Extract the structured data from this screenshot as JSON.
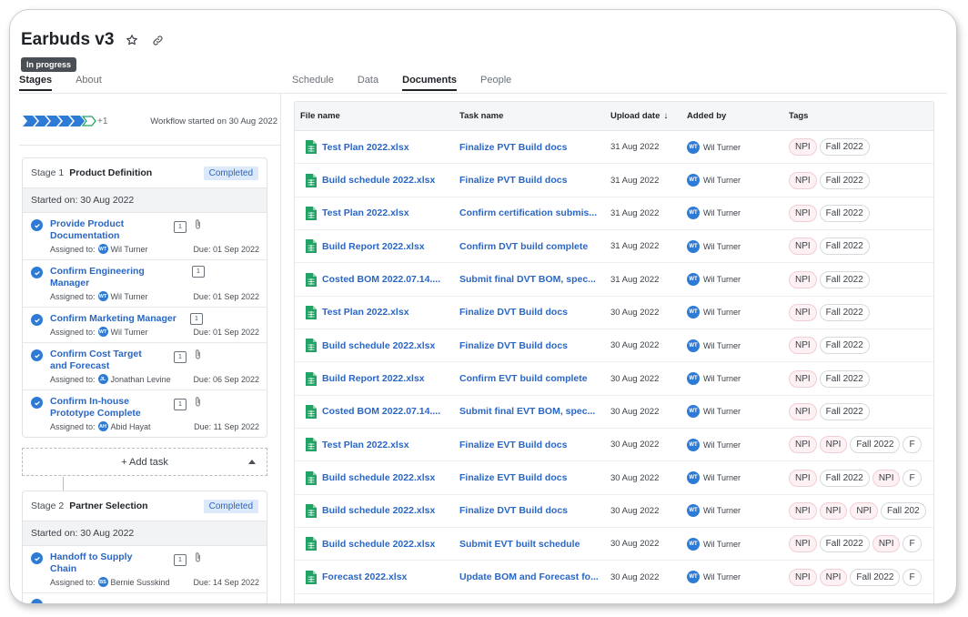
{
  "project": {
    "title": "Earbuds v3",
    "status": "In progress"
  },
  "left_tabs": [
    {
      "label": "Stages",
      "active": true
    },
    {
      "label": "About",
      "active": false
    }
  ],
  "right_tabs": [
    {
      "label": "Schedule",
      "active": false
    },
    {
      "label": "Data",
      "active": false
    },
    {
      "label": "Documents",
      "active": true
    },
    {
      "label": "People",
      "active": false
    }
  ],
  "workflow": {
    "extra_count": "+1",
    "started_text": "Workflow started on 30 Aug 2022"
  },
  "stages": [
    {
      "number": "Stage 1",
      "name": "Product Definition",
      "status": "Completed",
      "started": "Started on: 30 Aug 2022",
      "tasks": [
        {
          "title": "Provide Product Documentation",
          "assigned_label": "Assigned to:",
          "initials": "WT",
          "assignee": "Wil Turner",
          "due": "Due: 01 Sep 2022",
          "comments": "1",
          "attachment": true
        },
        {
          "title": "Confirm Engineering Manager",
          "assigned_label": "Assigned to:",
          "initials": "WT",
          "assignee": "Wil Turner",
          "due": "Due: 01 Sep 2022",
          "comments": "1",
          "attachment": false
        },
        {
          "title": "Confirm Marketing Manager",
          "assigned_label": "Assigned to:",
          "initials": "WT",
          "assignee": "Wil Turner",
          "due": "Due: 01 Sep 2022",
          "comments": "1",
          "attachment": false
        },
        {
          "title": "Confirm Cost Target and Forecast",
          "assigned_label": "Assigned to:",
          "initials": "JL",
          "assignee": "Jonathan Levine",
          "due": "Due: 06 Sep 2022",
          "comments": "1",
          "attachment": true
        },
        {
          "title": "Confirm In-house Prototype Complete",
          "assigned_label": "Assigned to:",
          "initials": "AH",
          "assignee": "Abid Hayat",
          "due": "Due: 11 Sep 2022",
          "comments": "1",
          "attachment": true
        }
      ],
      "add_task": "+ Add task"
    },
    {
      "number": "Stage 2",
      "name": "Partner Selection",
      "status": "Completed",
      "started": "Started on: 30 Aug 2022",
      "tasks": [
        {
          "title": "Handoff to Supply Chain",
          "assigned_label": "Assigned to:",
          "initials": "BS",
          "assignee": "Bernie Susskind",
          "due": "Due: 14 Sep 2022",
          "comments": "1",
          "attachment": true
        }
      ]
    }
  ],
  "documents": {
    "columns": {
      "file": "File name",
      "task": "Task name",
      "date": "Upload date",
      "added": "Added by",
      "tags": "Tags"
    },
    "sort_icon": "arrow-down-icon",
    "rows": [
      {
        "file": "Test Plan 2022.xlsx",
        "task": "Finalize PVT Build docs",
        "date": "31 Aug 2022",
        "initials": "WT",
        "added": "Wil Turner",
        "tags": [
          "NPI",
          "Fall 2022"
        ]
      },
      {
        "file": "Build schedule 2022.xlsx",
        "task": "Finalize PVT Build docs",
        "date": "31 Aug 2022",
        "initials": "WT",
        "added": "Wil Turner",
        "tags": [
          "NPI",
          "Fall 2022"
        ]
      },
      {
        "file": "Test Plan 2022.xlsx",
        "task": "Confirm certification submis...",
        "date": "31 Aug 2022",
        "initials": "WT",
        "added": "Wil Turner",
        "tags": [
          "NPI",
          "Fall 2022"
        ]
      },
      {
        "file": "Build Report 2022.xlsx",
        "task": "Confirm DVT build complete",
        "date": "31 Aug 2022",
        "initials": "WT",
        "added": "Wil Turner",
        "tags": [
          "NPI",
          "Fall 2022"
        ]
      },
      {
        "file": "Costed BOM 2022.07.14....",
        "task": "Submit final DVT BOM, spec...",
        "date": "31 Aug 2022",
        "initials": "WT",
        "added": "Wil Turner",
        "tags": [
          "NPI",
          "Fall 2022"
        ]
      },
      {
        "file": "Test Plan 2022.xlsx",
        "task": "Finalize DVT Build docs",
        "date": "30 Aug 2022",
        "initials": "WT",
        "added": "Wil Turner",
        "tags": [
          "NPI",
          "Fall 2022"
        ]
      },
      {
        "file": "Build schedule 2022.xlsx",
        "task": "Finalize DVT Build docs",
        "date": "30 Aug 2022",
        "initials": "WT",
        "added": "Wil Turner",
        "tags": [
          "NPI",
          "Fall 2022"
        ]
      },
      {
        "file": "Build Report 2022.xlsx",
        "task": "Confirm EVT build complete",
        "date": "30 Aug 2022",
        "initials": "WT",
        "added": "Wil Turner",
        "tags": [
          "NPI",
          "Fall 2022"
        ]
      },
      {
        "file": "Costed BOM 2022.07.14....",
        "task": "Submit final EVT BOM, spec...",
        "date": "30 Aug 2022",
        "initials": "WT",
        "added": "Wil Turner",
        "tags": [
          "NPI",
          "Fall 2022"
        ]
      },
      {
        "file": "Test Plan 2022.xlsx",
        "task": "Finalize EVT Build docs",
        "date": "30 Aug 2022",
        "initials": "WT",
        "added": "Wil Turner",
        "tags": [
          "NPI",
          "NPI",
          "Fall 2022",
          "F"
        ]
      },
      {
        "file": "Build schedule 2022.xlsx",
        "task": "Finalize EVT Build docs",
        "date": "30 Aug 2022",
        "initials": "WT",
        "added": "Wil Turner",
        "tags": [
          "NPI",
          "Fall 2022",
          "NPI",
          "F"
        ]
      },
      {
        "file": "Build schedule 2022.xlsx",
        "task": "Finalize DVT Build docs",
        "date": "30 Aug 2022",
        "initials": "WT",
        "added": "Wil Turner",
        "tags": [
          "NPI",
          "NPI",
          "NPI",
          "Fall 202"
        ]
      },
      {
        "file": "Build schedule 2022.xlsx",
        "task": "Submit EVT built schedule",
        "date": "30 Aug 2022",
        "initials": "WT",
        "added": "Wil Turner",
        "tags": [
          "NPI",
          "Fall 2022",
          "NPI",
          "F"
        ]
      },
      {
        "file": "Forecast 2022.xlsx",
        "task": "Update BOM and Forecast fo...",
        "date": "30 Aug 2022",
        "initials": "WT",
        "added": "Wil Turner",
        "tags": [
          "NPI",
          "NPI",
          "Fall 2022",
          "F"
        ]
      }
    ]
  },
  "colors": {
    "link": "#2a66c4",
    "accent": "#2e7bd6",
    "file_green": "#21a366"
  }
}
